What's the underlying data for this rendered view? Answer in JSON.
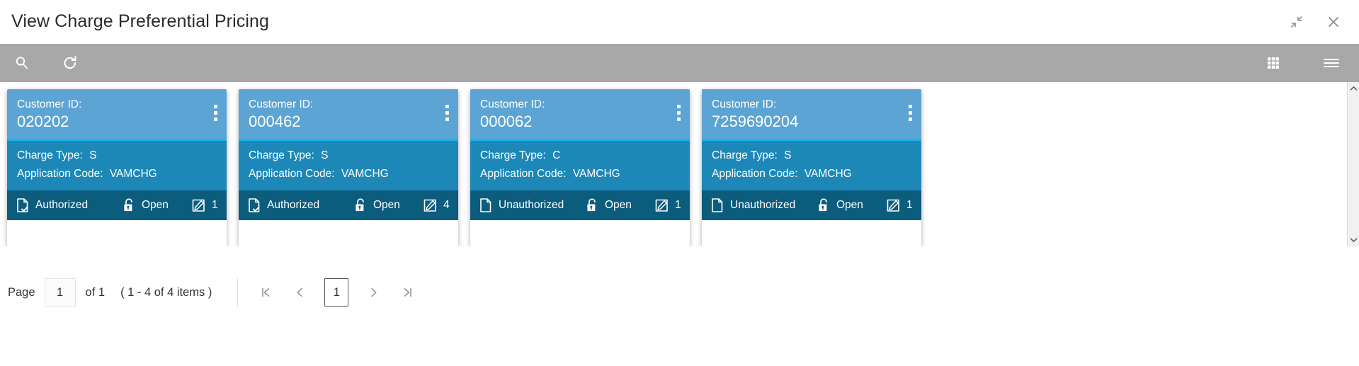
{
  "window": {
    "title": "View Charge Preferential Pricing",
    "minimize_icon": "collapse-arrows-icon",
    "close_icon": "close-icon"
  },
  "toolbar": {
    "search_icon": "search-icon",
    "refresh_icon": "refresh-icon",
    "grid_view_icon": "grid-view-icon",
    "menu_icon": "hamburger-menu-icon",
    "background": "#a8a8a8"
  },
  "colors": {
    "card_header": "#5ca4d4",
    "card_divider": "#17b4ec",
    "card_body": "#1d88b8",
    "card_footer": "#0c5c7d"
  },
  "cards": [
    {
      "id_label": "Customer ID:",
      "id_value": "020202",
      "charge_type_label": "Charge Type:",
      "charge_type_value": "S",
      "app_code_label": "Application Code:",
      "app_code_value": "VAMCHG",
      "auth_status": "Authorized",
      "lock_status": "Open",
      "version": "1",
      "menu_icon": "kebab-menu-icon"
    },
    {
      "id_label": "Customer ID:",
      "id_value": "000462",
      "charge_type_label": "Charge Type:",
      "charge_type_value": "S",
      "app_code_label": "Application Code:",
      "app_code_value": "VAMCHG",
      "auth_status": "Authorized",
      "lock_status": "Open",
      "version": "4",
      "menu_icon": "kebab-menu-icon"
    },
    {
      "id_label": "Customer ID:",
      "id_value": "000062",
      "charge_type_label": "Charge Type:",
      "charge_type_value": "C",
      "app_code_label": "Application Code:",
      "app_code_value": "VAMCHG",
      "auth_status": "Unauthorized",
      "lock_status": "Open",
      "version": "1",
      "menu_icon": "kebab-menu-icon"
    },
    {
      "id_label": "Customer ID:",
      "id_value": "7259690204",
      "charge_type_label": "Charge Type:",
      "charge_type_value": "S",
      "app_code_label": "Application Code:",
      "app_code_value": "VAMCHG",
      "auth_status": "Unauthorized",
      "lock_status": "Open",
      "version": "1",
      "menu_icon": "kebab-menu-icon"
    }
  ],
  "pagination": {
    "page_label": "Page",
    "page_value": "1",
    "of_text": "of 1",
    "items_text": "( 1 - 4 of 4 items )",
    "first_icon": "first-page-icon",
    "prev_icon": "previous-page-icon",
    "current_page": "1",
    "next_icon": "next-page-icon",
    "last_icon": "last-page-icon"
  },
  "scrollbar": {
    "up_icon": "scroll-up-icon",
    "down_icon": "scroll-down-icon"
  }
}
